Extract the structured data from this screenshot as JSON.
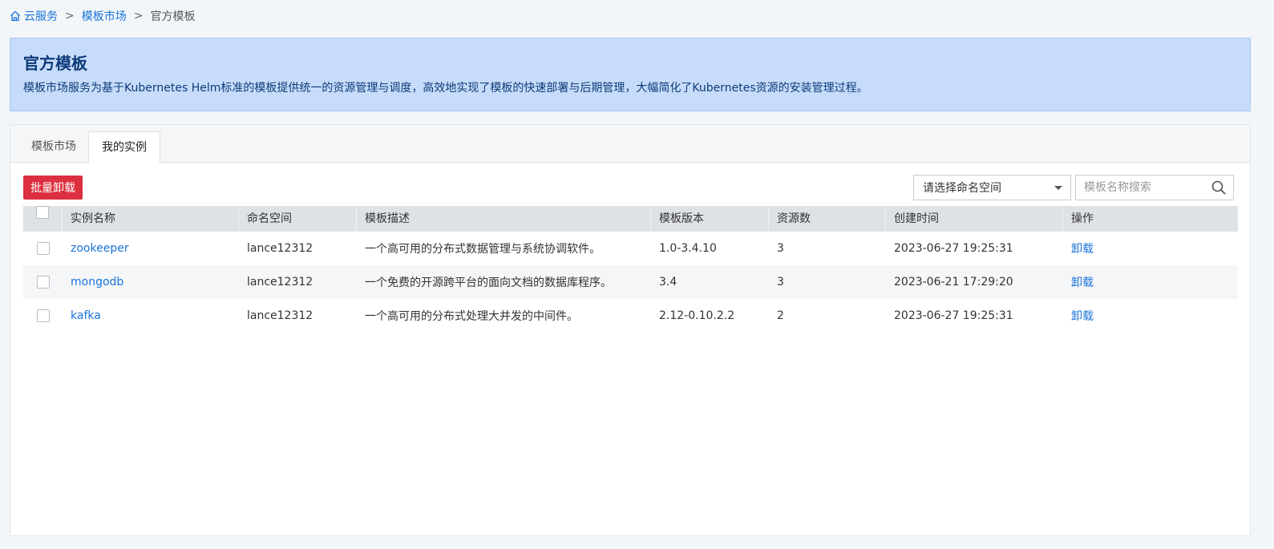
{
  "breadcrumb": {
    "items": [
      "云服务",
      "模板市场",
      "官方模板"
    ],
    "separator": ">"
  },
  "banner": {
    "title": "官方模板",
    "description": "模板市场服务为基于Kubernetes Helm标准的模板提供统一的资源管理与调度，高效地实现了模板的快速部署与后期管理，大幅简化了Kubernetes资源的安装管理过程。"
  },
  "tabs": [
    {
      "label": "模板市场",
      "active": false
    },
    {
      "label": "我的实例",
      "active": true
    }
  ],
  "toolbar": {
    "batch_uninstall_label": "批量卸载",
    "namespace_select_value": "请选择命名空间",
    "search_placeholder": "模板名称搜索"
  },
  "table": {
    "columns": [
      "实例名称",
      "命名空间",
      "模板描述",
      "模板版本",
      "资源数",
      "创建时间",
      "操作"
    ],
    "rows": [
      {
        "name": "zookeeper",
        "namespace": "lance12312",
        "description": "一个高可用的分布式数据管理与系统协调软件。",
        "version": "1.0-3.4.10",
        "resources": "3",
        "created": "2023-06-27 19:25:31",
        "action": "卸载"
      },
      {
        "name": "mongodb",
        "namespace": "lance12312",
        "description": "一个免费的开源跨平台的面向文档的数据库程序。",
        "version": "3.4",
        "resources": "3",
        "created": "2023-06-21 17:29:20",
        "action": "卸载"
      },
      {
        "name": "kafka",
        "namespace": "lance12312",
        "description": "一个高可用的分布式处理大并发的中间件。",
        "version": "2.12-0.10.2.2",
        "resources": "2",
        "created": "2023-06-27 19:25:31",
        "action": "卸载"
      }
    ]
  },
  "colors": {
    "link": "#1a73d9",
    "danger": "#dc2f3f",
    "banner_bg": "#c7dcfa",
    "banner_text": "#0d3a78"
  }
}
